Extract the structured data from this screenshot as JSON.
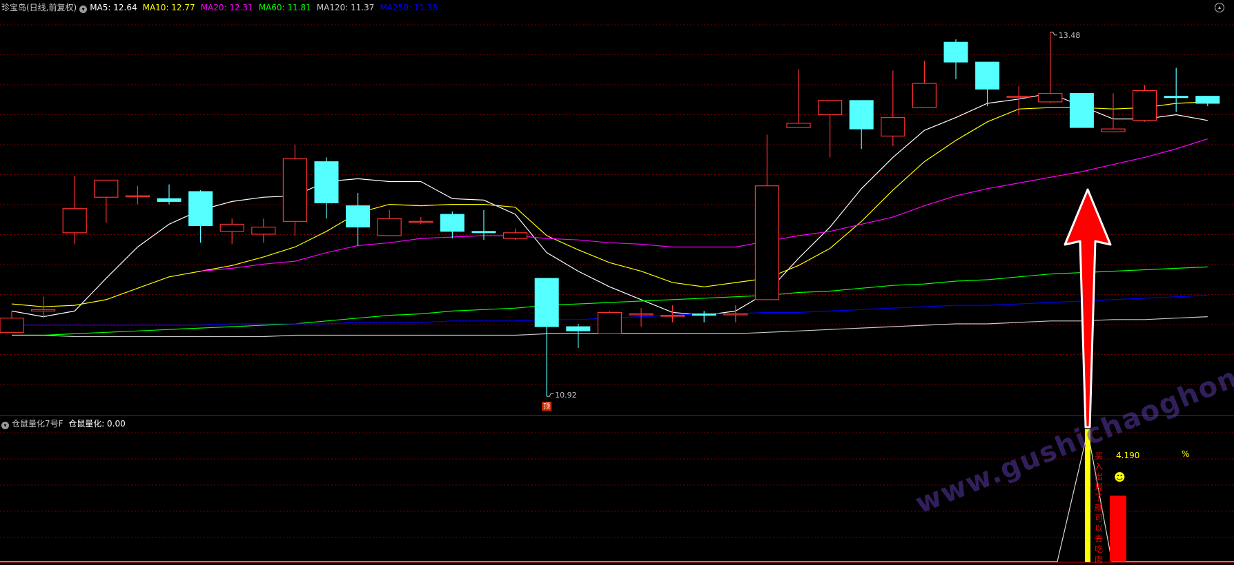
{
  "header": {
    "title": "珍宝岛(日线,前复权)",
    "ma": [
      {
        "label": "MA5: 12.64",
        "color": "#ffffff"
      },
      {
        "label": "MA10: 12.77",
        "color": "#ffff00"
      },
      {
        "label": "MA20: 12.31",
        "color": "#ff00ff"
      },
      {
        "label": "MA60: 11.81",
        "color": "#00ff00"
      },
      {
        "label": "MA120: 11.37",
        "color": "#c8c8c8"
      },
      {
        "label": "MA250: 11.38",
        "color": "#0000ff"
      }
    ]
  },
  "sub_header": {
    "title": "仓鼠量化7号F",
    "value_label": "仓鼠量化: 0.00"
  },
  "annotations": {
    "high_label": "13.48",
    "low_label": "10.92",
    "low_badge": "顶",
    "indicator_value": "4.190",
    "percent": "%",
    "smiley": "☻",
    "bar_text": [
      "买",
      "入",
      "出",
      "现",
      "了",
      "就",
      "可",
      "以",
      "去",
      "吃",
      "肉"
    ]
  },
  "watermark": "www.gushichaoghong.com",
  "colors": {
    "up": "#ff3232",
    "down": "#54ffff",
    "grid": "#7a0000",
    "arrow": "#ff0000",
    "signal": "#ffff00"
  },
  "chart_data": {
    "type": "candlestick",
    "price_range": [
      10.8,
      13.6
    ],
    "candles": [
      {
        "o": 11.37,
        "h": 11.52,
        "l": 11.37,
        "c": 11.47
      },
      {
        "o": 11.52,
        "h": 11.62,
        "l": 11.47,
        "c": 11.53
      },
      {
        "o": 12.07,
        "h": 12.47,
        "l": 11.99,
        "c": 12.24
      },
      {
        "o": 12.32,
        "h": 12.44,
        "l": 12.14,
        "c": 12.44
      },
      {
        "o": 12.33,
        "h": 12.4,
        "l": 12.27,
        "c": 12.33
      },
      {
        "o": 12.31,
        "h": 12.41,
        "l": 12.27,
        "c": 12.29
      },
      {
        "o": 12.36,
        "h": 12.37,
        "l": 12.0,
        "c": 12.12
      },
      {
        "o": 12.08,
        "h": 12.17,
        "l": 11.99,
        "c": 12.13
      },
      {
        "o": 12.06,
        "h": 12.17,
        "l": 12.0,
        "c": 12.11
      },
      {
        "o": 12.15,
        "h": 12.69,
        "l": 12.05,
        "c": 12.59
      },
      {
        "o": 12.57,
        "h": 12.6,
        "l": 12.17,
        "c": 12.28
      },
      {
        "o": 12.26,
        "h": 12.35,
        "l": 11.98,
        "c": 12.11
      },
      {
        "o": 12.05,
        "h": 12.23,
        "l": 12.05,
        "c": 12.17
      },
      {
        "o": 12.15,
        "h": 12.18,
        "l": 12.13,
        "c": 12.15
      },
      {
        "o": 12.2,
        "h": 12.22,
        "l": 12.03,
        "c": 12.08
      },
      {
        "o": 12.08,
        "h": 12.23,
        "l": 12.02,
        "c": 12.07
      },
      {
        "o": 12.03,
        "h": 12.1,
        "l": 12.02,
        "c": 12.07
      },
      {
        "o": 11.75,
        "h": 11.75,
        "l": 10.92,
        "c": 11.41
      },
      {
        "o": 11.41,
        "h": 11.43,
        "l": 11.26,
        "c": 11.38
      },
      {
        "o": 11.36,
        "h": 11.52,
        "l": 11.36,
        "c": 11.51
      },
      {
        "o": 11.5,
        "h": 11.54,
        "l": 11.41,
        "c": 11.5
      },
      {
        "o": 11.49,
        "h": 11.56,
        "l": 11.44,
        "c": 11.49
      },
      {
        "o": 11.5,
        "h": 11.52,
        "l": 11.44,
        "c": 11.49
      },
      {
        "o": 11.5,
        "h": 11.56,
        "l": 11.44,
        "c": 11.5
      },
      {
        "o": 11.6,
        "h": 12.76,
        "l": 11.6,
        "c": 12.4
      },
      {
        "o": 12.81,
        "h": 13.22,
        "l": 12.81,
        "c": 12.84
      },
      {
        "o": 12.9,
        "h": 13.0,
        "l": 12.6,
        "c": 13.0
      },
      {
        "o": 13.0,
        "h": 13.0,
        "l": 12.66,
        "c": 12.8
      },
      {
        "o": 12.75,
        "h": 13.21,
        "l": 12.68,
        "c": 12.88
      },
      {
        "o": 12.95,
        "h": 13.28,
        "l": 12.95,
        "c": 13.12
      },
      {
        "o": 13.41,
        "h": 13.43,
        "l": 13.15,
        "c": 13.27
      },
      {
        "o": 13.27,
        "h": 13.27,
        "l": 12.96,
        "c": 13.08
      },
      {
        "o": 13.03,
        "h": 13.1,
        "l": 12.9,
        "c": 13.03
      },
      {
        "o": 12.99,
        "h": 13.48,
        "l": 12.98,
        "c": 13.05
      },
      {
        "o": 13.05,
        "h": 13.05,
        "l": 12.82,
        "c": 12.81
      },
      {
        "o": 12.78,
        "h": 13.05,
        "l": 12.78,
        "c": 12.8
      },
      {
        "o": 12.86,
        "h": 13.11,
        "l": 12.85,
        "c": 13.07
      },
      {
        "o": 13.03,
        "h": 13.23,
        "l": 12.92,
        "c": 13.02
      },
      {
        "o": 13.03,
        "h": 13.03,
        "l": 12.96,
        "c": 12.98
      }
    ],
    "ma": {
      "MA5": [
        11.52,
        11.48,
        11.52,
        11.75,
        11.97,
        12.13,
        12.23,
        12.29,
        12.32,
        12.33,
        12.43,
        12.45,
        12.43,
        12.43,
        12.31,
        12.3,
        12.2,
        11.93,
        11.8,
        11.69,
        11.6,
        11.51,
        11.49,
        11.52,
        11.65,
        11.89,
        12.11,
        12.38,
        12.6,
        12.79,
        12.88,
        12.98,
        13.01,
        13.05,
        12.96,
        12.87,
        12.87,
        12.9,
        12.86
      ],
      "MA10": [
        11.57,
        11.55,
        11.56,
        11.6,
        11.68,
        11.76,
        11.8,
        11.84,
        11.9,
        11.97,
        12.08,
        12.21,
        12.27,
        12.26,
        12.27,
        12.27,
        12.25,
        12.05,
        11.95,
        11.86,
        11.8,
        11.72,
        11.69,
        11.72,
        11.75,
        11.84,
        11.96,
        12.15,
        12.37,
        12.57,
        12.72,
        12.85,
        12.94,
        12.95,
        12.95,
        12.94,
        12.95,
        12.98,
        12.99
      ],
      "MA20": [
        null,
        null,
        null,
        null,
        null,
        null,
        11.8,
        11.82,
        11.85,
        11.87,
        11.93,
        11.98,
        12.0,
        12.03,
        12.04,
        12.05,
        12.05,
        12.03,
        12.02,
        12.0,
        11.99,
        11.97,
        11.97,
        11.97,
        12.01,
        12.05,
        12.08,
        12.13,
        12.18,
        12.26,
        12.33,
        12.38,
        12.42,
        12.46,
        12.5,
        12.55,
        12.6,
        12.66,
        12.73
      ],
      "MA60": [
        11.35,
        11.35,
        11.36,
        11.37,
        11.38,
        11.39,
        11.4,
        11.41,
        11.42,
        11.43,
        11.45,
        11.47,
        11.49,
        11.5,
        11.52,
        11.53,
        11.54,
        11.56,
        11.57,
        11.58,
        11.59,
        11.6,
        11.61,
        11.62,
        11.63,
        11.65,
        11.66,
        11.68,
        11.7,
        11.71,
        11.73,
        11.74,
        11.76,
        11.78,
        11.79,
        11.8,
        11.81,
        11.82,
        11.83
      ],
      "MA120": [
        11.35,
        11.35,
        11.34,
        11.34,
        11.34,
        11.34,
        11.34,
        11.34,
        11.34,
        11.35,
        11.35,
        11.35,
        11.35,
        11.35,
        11.35,
        11.35,
        11.35,
        11.36,
        11.36,
        11.36,
        11.36,
        11.36,
        11.36,
        11.36,
        11.37,
        11.38,
        11.39,
        11.4,
        11.41,
        11.42,
        11.43,
        11.43,
        11.44,
        11.45,
        11.45,
        11.46,
        11.46,
        11.47,
        11.48
      ],
      "MA250": [
        11.42,
        11.42,
        11.42,
        11.42,
        11.42,
        11.42,
        11.42,
        11.43,
        11.43,
        11.43,
        11.43,
        11.44,
        11.44,
        11.44,
        11.45,
        11.45,
        11.45,
        11.46,
        11.46,
        11.47,
        11.48,
        11.49,
        11.5,
        11.5,
        11.51,
        11.51,
        11.52,
        11.53,
        11.54,
        11.55,
        11.56,
        11.56,
        11.57,
        11.58,
        11.59,
        11.6,
        11.61,
        11.62,
        11.63
      ]
    },
    "signal_index": 34,
    "indicator_series": [
      0,
      0,
      0,
      0,
      0,
      0,
      0,
      0,
      0,
      0,
      0,
      0,
      0,
      0,
      0,
      0,
      0,
      0,
      0,
      0,
      0,
      0,
      0,
      0,
      0,
      0,
      0,
      0,
      0,
      0,
      0,
      0,
      0,
      0,
      1.0,
      0,
      0,
      0,
      0
    ],
    "indicator_bar": 0.49
  }
}
